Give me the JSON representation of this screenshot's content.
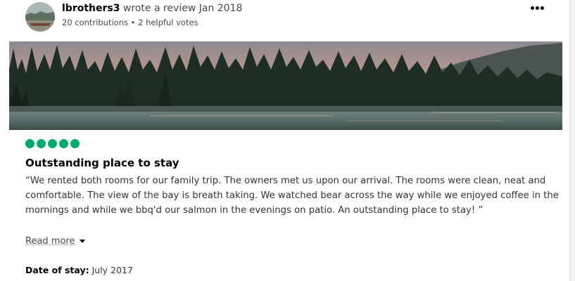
{
  "review": {
    "reviewer": {
      "name": "lbrothers3",
      "action_text": " wrote a review Jan 2018",
      "contributions": "20 contributions",
      "separator": " • ",
      "helpful_votes": "2 helpful votes",
      "avatar_icon": "avatar-photo-icon"
    },
    "more_menu_icon": "more-options-icon",
    "photo_icon": "review-photo-lake-forest",
    "rating": {
      "value": 5,
      "max": 5,
      "color": "#00aa6c"
    },
    "title": "Outstanding place to stay",
    "text": "“We rented both rooms for our family trip. The owners met us upon our arrival. The rooms were clean, neat and comfortable. The view of the bay is breath taking. We watched bear across the way while we enjoyed coffee in the mornings and while we bbq'd our salmon in the evenings on patio. An outstanding place to stay! ”",
    "read_more_label": "Read more",
    "read_more_icon": "chevron-down-icon",
    "date_of_stay": {
      "label": "Date of stay:",
      "value": " July 2017"
    }
  }
}
